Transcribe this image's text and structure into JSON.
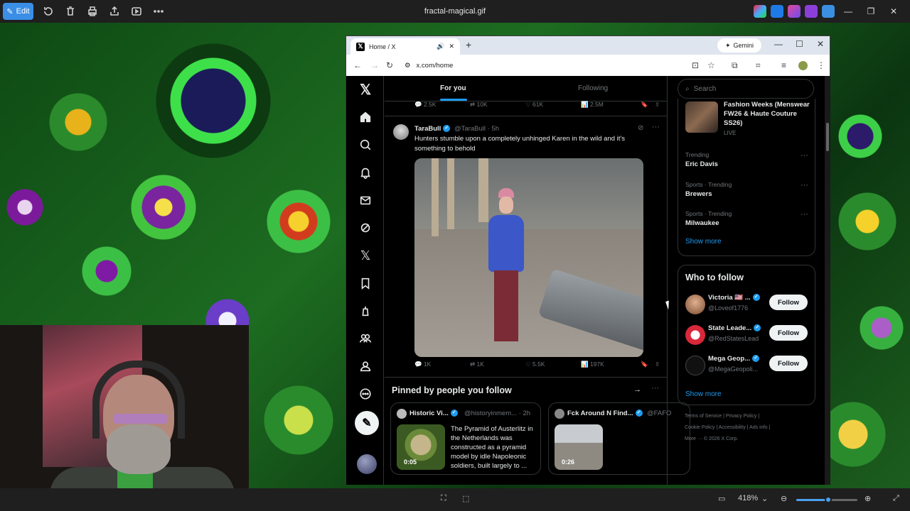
{
  "viewer": {
    "edit_label": "Edit",
    "file_title": "fractal-magical.gif",
    "zoom": "418%",
    "zoom_level": 0.52
  },
  "browser": {
    "tab_title": "Home / X",
    "gemini_label": "Gemini",
    "url": "x.com/home"
  },
  "feed": {
    "tabs": [
      "For you",
      "Following"
    ],
    "prev_metrics": {
      "replies": "2.5K",
      "reposts": "10K",
      "likes": "61K",
      "views": "2.5M"
    },
    "tweet": {
      "name": "TaraBull",
      "handle": "@TaraBull · 5h",
      "text": "Hunters stumble upon a completely unhinged Karen in the wild and it's something to behold",
      "metrics": {
        "replies": "1K",
        "reposts": "1K",
        "likes": "5.5K",
        "views": "197K"
      }
    },
    "pinned_title": "Pinned by people you follow",
    "pinned": [
      {
        "name": "Historic Vi...",
        "handle": "@historyinmem... · 2h",
        "duration": "0:05",
        "text": "The Pyramid of Austerlitz in the Netherlands was constructed as a pyramid model by idle Napoleonic soldiers, built largely to ..."
      },
      {
        "name": "Fck Around N Find...",
        "handle": "@FAFO",
        "duration": "0:26",
        "text": ""
      }
    ]
  },
  "sidebar": {
    "search_placeholder": "Search",
    "event": {
      "title": "Fashion Weeks (Menswear FW26 & Haute Couture SS26)",
      "status": "LIVE"
    },
    "trends": [
      {
        "category": "Trending",
        "name": "Eric Davis"
      },
      {
        "category": "Sports · Trending",
        "name": "Brewers"
      },
      {
        "category": "Sports · Trending",
        "name": "Milwaukee"
      }
    ],
    "show_more": "Show more",
    "who_to_follow_title": "Who to follow",
    "follow_users": [
      {
        "name": "Victoria 🇺🇸 ...",
        "handle": "@Loveof1776",
        "button": "Follow"
      },
      {
        "name": "State Leade...",
        "handle": "@RedStatesLead",
        "button": "Follow"
      },
      {
        "name": "Mega Geop...",
        "handle": "@MegaGeopoli...",
        "button": "Follow"
      }
    ],
    "footer": {
      "line1": "Terms of Service  |  Privacy Policy  |",
      "line2": "Cookie Policy  |  Accessibility  |  Ads info  |",
      "line3": "More ···   © 2026 X Corp."
    }
  }
}
